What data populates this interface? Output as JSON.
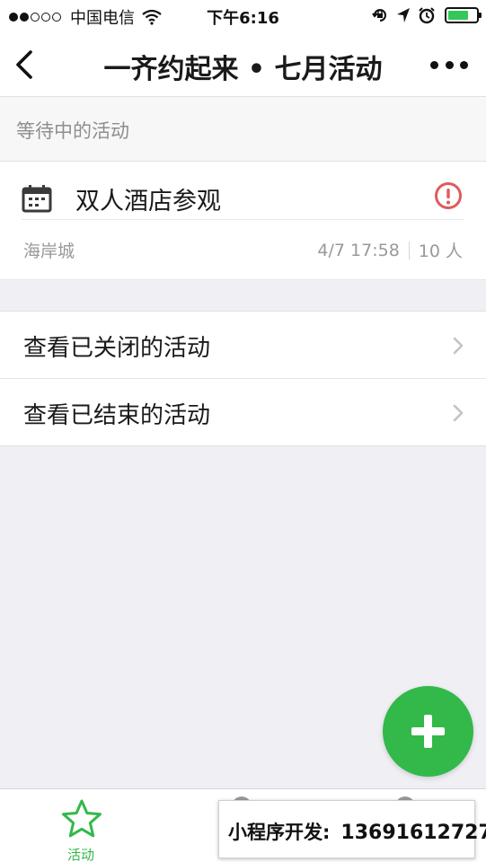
{
  "status_bar": {
    "carrier": "中国电信",
    "time": "下午6:16",
    "signal_bars_filled": 2,
    "signal_bars_total": 5,
    "battery_level": 0.75,
    "icons": [
      "wifi-icon",
      "rotation-lock-icon",
      "location-arrow-icon",
      "alarm-icon",
      "battery-icon"
    ]
  },
  "nav": {
    "title": "一齐约起来 • 七月活动",
    "back_icon": "chevron-left-icon",
    "more_icon": "more-dots-icon"
  },
  "section": {
    "pending_title": "等待中的活动"
  },
  "activity": {
    "title": "双人酒店参观",
    "location": "海岸城",
    "datetime": "4/7 17:58",
    "participants": "10 人",
    "icon": "calendar-icon",
    "status_icon": "alert-icon"
  },
  "links": [
    {
      "label": "查看已关闭的活动"
    },
    {
      "label": "查看已结束的活动"
    }
  ],
  "fab": {
    "icon": "plus-icon"
  },
  "tab_bar": {
    "tabs": [
      {
        "label": "活动",
        "icon": "star-icon",
        "active": true
      }
    ]
  },
  "watermark": {
    "label": "小程序开发:",
    "phone": "13691612727"
  },
  "colors": {
    "accent": "#33b84a",
    "alert": "#e05a5a",
    "background": "#efeff4"
  }
}
